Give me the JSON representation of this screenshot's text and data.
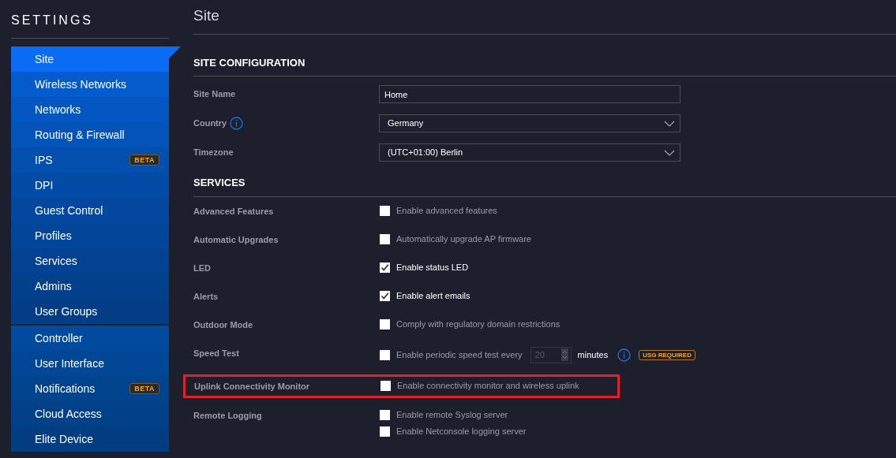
{
  "sidebar": {
    "title": "SETTINGS",
    "groups": [
      {
        "items": [
          {
            "label": "Site",
            "selected": true
          },
          {
            "label": "Wireless Networks",
            "selected": false
          },
          {
            "label": "Networks",
            "selected": false
          },
          {
            "label": "Routing & Firewall",
            "selected": false
          },
          {
            "label": "IPS",
            "selected": false,
            "badge": "BETA"
          },
          {
            "label": "DPI",
            "selected": false
          },
          {
            "label": "Guest Control",
            "selected": false
          },
          {
            "label": "Profiles",
            "selected": false
          },
          {
            "label": "Services",
            "selected": false
          },
          {
            "label": "Admins",
            "selected": false
          },
          {
            "label": "User Groups",
            "selected": false
          }
        ]
      },
      {
        "items": [
          {
            "label": "Controller",
            "selected": false
          },
          {
            "label": "User Interface",
            "selected": false
          },
          {
            "label": "Notifications",
            "selected": false,
            "badge": "BETA"
          },
          {
            "label": "Cloud Access",
            "selected": false
          },
          {
            "label": "Elite Device",
            "selected": false
          }
        ]
      }
    ]
  },
  "page": {
    "title": "Site"
  },
  "site_configuration": {
    "heading": "SITE CONFIGURATION",
    "fields": [
      {
        "label": "Site Name",
        "kind": "text",
        "value": "Home",
        "info": false
      },
      {
        "label": "Country",
        "kind": "select",
        "value": "Germany",
        "info": true
      },
      {
        "label": "Timezone",
        "kind": "select",
        "value": "(UTC+01:00) Berlin",
        "info": false
      }
    ]
  },
  "services": {
    "heading": "SERVICES",
    "rows": [
      {
        "label": "Advanced Features",
        "kind": "checkbox",
        "highlighted": false,
        "options": [
          {
            "text": "Enable advanced features",
            "checked": false
          }
        ]
      },
      {
        "label": "Automatic Upgrades",
        "kind": "checkbox",
        "highlighted": false,
        "options": [
          {
            "text": "Automatically upgrade AP firmware",
            "checked": false
          }
        ]
      },
      {
        "label": "LED",
        "kind": "checkbox",
        "highlighted": false,
        "options": [
          {
            "text": "Enable status LED",
            "checked": true
          }
        ]
      },
      {
        "label": "Alerts",
        "kind": "checkbox",
        "highlighted": false,
        "options": [
          {
            "text": "Enable alert emails",
            "checked": true
          }
        ]
      },
      {
        "label": "Outdoor Mode",
        "kind": "checkbox",
        "highlighted": false,
        "options": [
          {
            "text": "Comply with regulatory domain restrictions",
            "checked": false
          }
        ]
      },
      {
        "label": "Speed Test",
        "kind": "interval",
        "highlighted": false,
        "options": [
          {
            "text": "Enable periodic speed test every",
            "checked": false
          }
        ],
        "interval": "20",
        "unit": "minutes",
        "badge": "USG REQUIRED"
      },
      {
        "label": "Uplink Connectivity Monitor",
        "kind": "checkbox",
        "highlighted": true,
        "options": [
          {
            "text": "Enable connectivity monitor and wireless uplink",
            "checked": false
          }
        ]
      },
      {
        "label": "Remote Logging",
        "kind": "checkbox",
        "highlighted": false,
        "options": [
          {
            "text": "Enable remote Syslog server",
            "checked": false
          },
          {
            "text": "Enable Netconsole logging server",
            "checked": false
          }
        ]
      }
    ]
  }
}
